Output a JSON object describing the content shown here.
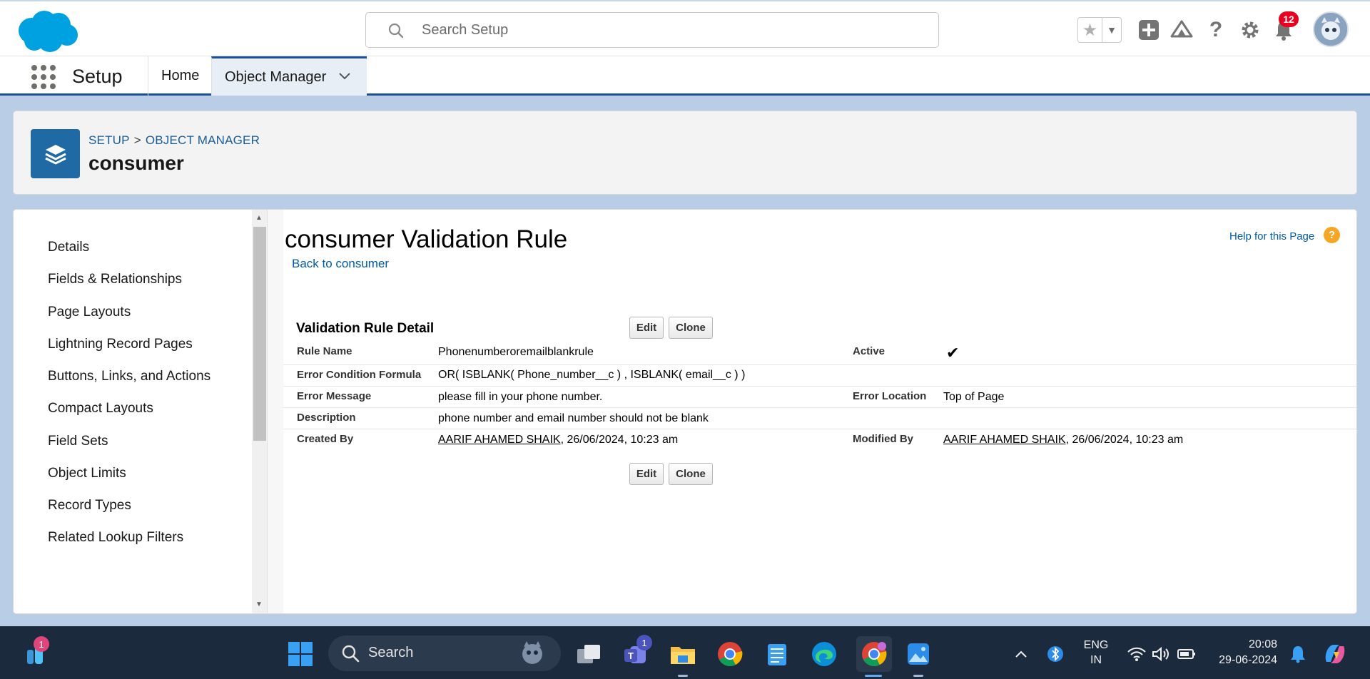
{
  "header": {
    "search_placeholder": "Search Setup",
    "notification_count": "12"
  },
  "context_bar": {
    "app_name": "Setup",
    "tabs": [
      {
        "label": "Home"
      },
      {
        "label": "Object Manager"
      }
    ]
  },
  "page_header": {
    "breadcrumb": [
      "SETUP",
      "OBJECT MANAGER"
    ],
    "breadcrumb_sep": ">",
    "title": "consumer"
  },
  "sidebar": {
    "items": [
      {
        "label": "Details"
      },
      {
        "label": "Fields & Relationships"
      },
      {
        "label": "Page Layouts"
      },
      {
        "label": "Lightning Record Pages"
      },
      {
        "label": "Buttons, Links, and Actions"
      },
      {
        "label": "Compact Layouts"
      },
      {
        "label": "Field Sets"
      },
      {
        "label": "Object Limits"
      },
      {
        "label": "Record Types"
      },
      {
        "label": "Related Lookup Filters"
      }
    ]
  },
  "content": {
    "title": "consumer Validation Rule",
    "back_link": "Back to consumer",
    "help_link": "Help for this Page",
    "section_title": "Validation Rule Detail",
    "buttons": {
      "edit": "Edit",
      "clone": "Clone"
    },
    "fields": {
      "rule_name_label": "Rule Name",
      "rule_name": "Phonenumberoremailblankrule",
      "active_label": "Active",
      "active": true,
      "formula_label": "Error Condition Formula",
      "formula": "OR( ISBLANK( Phone_number__c ) , ISBLANK( email__c ) )",
      "error_message_label": "Error Message",
      "error_message": "please fill in your phone number.",
      "error_location_label": "Error Location",
      "error_location": "Top of Page",
      "description_label": "Description",
      "description": "phone number and email number should not be blank",
      "created_by_label": "Created By",
      "created_by_user": "AARIF AHAMED SHAIK",
      "created_by_date": ", 26/06/2024, 10:23 am",
      "modified_by_label": "Modified By",
      "modified_by_user": "AARIF AHAMED SHAIK",
      "modified_by_date": ", 26/06/2024, 10:23 am"
    }
  },
  "taskbar": {
    "search_label": "Search",
    "widgets_badge": "1",
    "teams_badge": "1",
    "lang_line1": "ENG",
    "lang_line2": "IN",
    "time": "20:08",
    "date": "29-06-2024"
  },
  "colors": {
    "brand_blue": "#1b5297",
    "link_blue": "#015ba7",
    "icon_tile": "#1f6aa5",
    "notification_red": "#ea001e",
    "salesforce_cloud": "#00a1e0"
  }
}
